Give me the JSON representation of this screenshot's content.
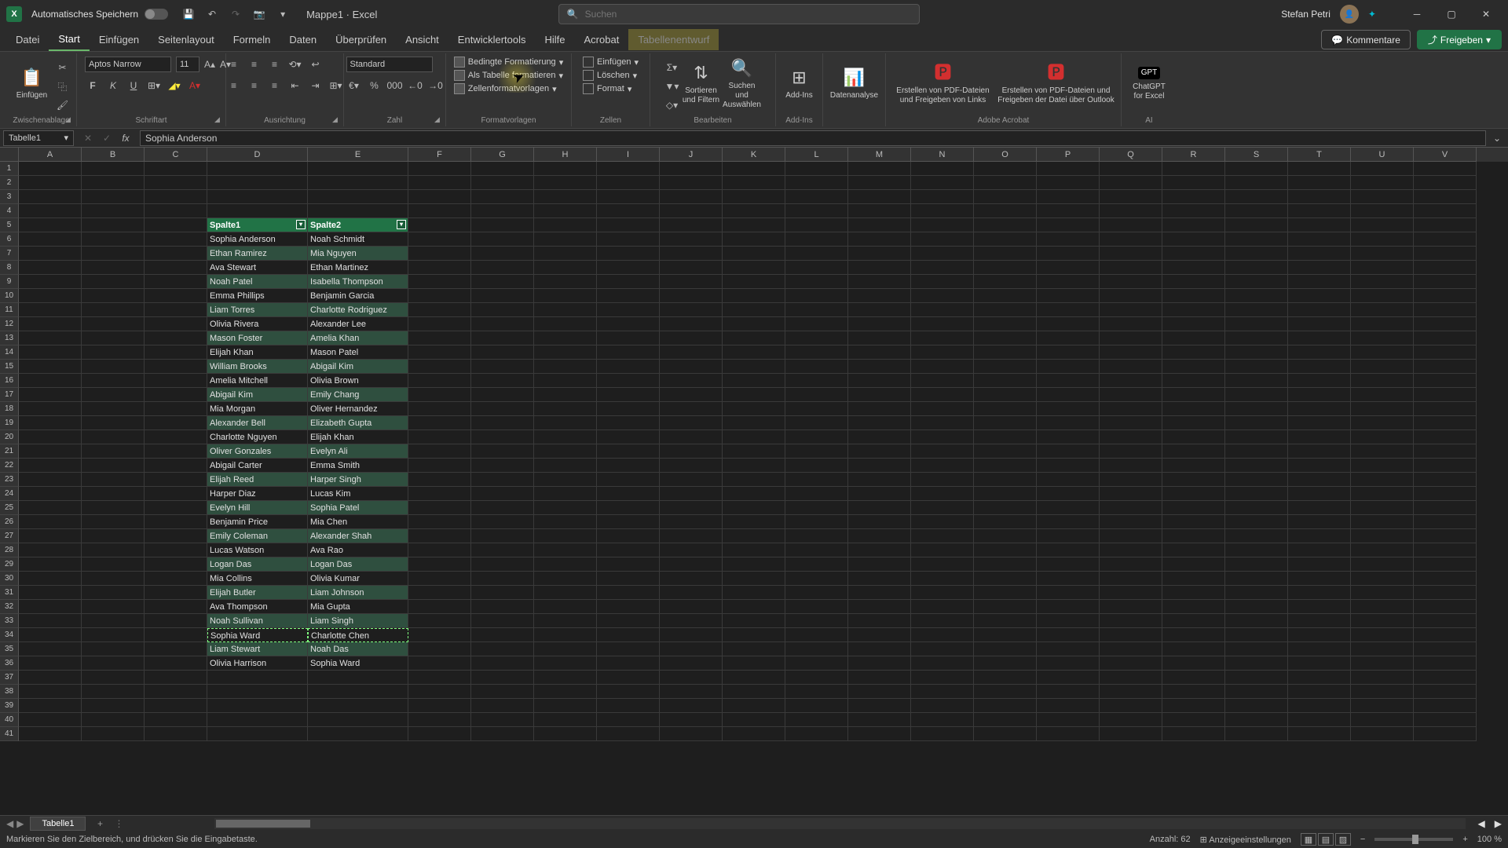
{
  "titlebar": {
    "autosave_label": "Automatisches Speichern",
    "filename": "Mappe1",
    "app": "Excel",
    "search_placeholder": "Suchen",
    "username": "Stefan Petri"
  },
  "tabs": {
    "items": [
      "Datei",
      "Start",
      "Einfügen",
      "Seitenlayout",
      "Formeln",
      "Daten",
      "Überprüfen",
      "Ansicht",
      "Entwicklertools",
      "Hilfe",
      "Acrobat",
      "Tabellenentwurf"
    ],
    "active": "Start",
    "kommentare": "Kommentare",
    "freigeben": "Freigeben"
  },
  "ribbon": {
    "clipboard": {
      "paste": "Einfügen",
      "label": "Zwischenablage"
    },
    "font": {
      "name": "Aptos Narrow",
      "size": "11",
      "label": "Schriftart"
    },
    "align": {
      "label": "Ausrichtung"
    },
    "number": {
      "format": "Standard",
      "label": "Zahl"
    },
    "styles": {
      "cond": "Bedingte Formatierung",
      "table": "Als Tabelle formatieren",
      "cell": "Zellenformatvorlagen",
      "label": "Formatvorlagen"
    },
    "cells": {
      "insert": "Einfügen",
      "delete": "Löschen",
      "format": "Format",
      "label": "Zellen"
    },
    "edit": {
      "sort": "Sortieren und Filtern",
      "find": "Suchen und Auswählen",
      "label": "Bearbeiten"
    },
    "addins": {
      "label": "Add-Ins",
      "btn": "Add-Ins"
    },
    "data_analysis": "Datenanalyse",
    "acrobat": {
      "pdf1": "Erstellen von PDF-Dateien und Freigeben von Links",
      "pdf2": "Erstellen von PDF-Dateien und Freigeben der Datei über Outlook",
      "label": "Adobe Acrobat"
    },
    "ai": {
      "gpt": "ChatGPT for Excel",
      "label": "AI"
    }
  },
  "formula": {
    "name_box": "Tabelle1",
    "content": "Sophia Anderson"
  },
  "grid": {
    "columns": [
      "A",
      "B",
      "C",
      "D",
      "E",
      "F",
      "G",
      "H",
      "I",
      "J",
      "K",
      "L",
      "M",
      "N",
      "O",
      "P",
      "Q",
      "R",
      "S",
      "T",
      "U",
      "V"
    ],
    "col_widths": {
      "A": 80,
      "B": 80,
      "C": 80,
      "D": 128,
      "E": 128,
      "default": 80
    },
    "table_start_row": 5,
    "table_col_d_header": "Spalte1",
    "table_col_e_header": "Spalte2",
    "table_rows": [
      [
        "Sophia Anderson",
        "Noah Schmidt"
      ],
      [
        "Ethan Ramirez",
        "Mia Nguyen"
      ],
      [
        "Ava Stewart",
        "Ethan Martinez"
      ],
      [
        "Noah Patel",
        "Isabella Thompson"
      ],
      [
        "Emma Phillips",
        "Benjamin Garcia"
      ],
      [
        "Liam Torres",
        "Charlotte Rodriguez"
      ],
      [
        "Olivia Rivera",
        "Alexander Lee"
      ],
      [
        "Mason Foster",
        "Amelia Khan"
      ],
      [
        "Elijah Khan",
        "Mason Patel"
      ],
      [
        "William Brooks",
        "Abigail Kim"
      ],
      [
        "Amelia Mitchell",
        "Olivia Brown"
      ],
      [
        "Abigail Kim",
        "Emily Chang"
      ],
      [
        "Mia Morgan",
        "Oliver Hernandez"
      ],
      [
        "Alexander Bell",
        "Elizabeth Gupta"
      ],
      [
        "Charlotte Nguyen",
        "Elijah Khan"
      ],
      [
        "Oliver Gonzales",
        "Evelyn Ali"
      ],
      [
        "Abigail Carter",
        "Emma Smith"
      ],
      [
        "Elijah Reed",
        "Harper Singh"
      ],
      [
        "Harper Diaz",
        "Lucas Kim"
      ],
      [
        "Evelyn Hill",
        "Sophia Patel"
      ],
      [
        "Benjamin Price",
        "Mia Chen"
      ],
      [
        "Emily Coleman",
        "Alexander Shah"
      ],
      [
        "Lucas Watson",
        "Ava Rao"
      ],
      [
        "Logan Das",
        "Logan Das"
      ],
      [
        "Mia Collins",
        "Olivia Kumar"
      ],
      [
        "Elijah Butler",
        "Liam Johnson"
      ],
      [
        "Ava Thompson",
        "Mia Gupta"
      ],
      [
        "Noah Sullivan",
        "Liam Singh"
      ],
      [
        "Sophia Ward",
        "Charlotte Chen"
      ],
      [
        "Liam Stewart",
        "Noah Das"
      ],
      [
        "Olivia Harrison",
        "Sophia Ward"
      ]
    ]
  },
  "sheets": {
    "active": "Tabelle1"
  },
  "status": {
    "message": "Markieren Sie den Zielbereich, und drücken Sie die Eingabetaste.",
    "anzahl_label": "Anzahl:",
    "anzahl_value": "62",
    "display_settings": "Anzeigeeinstellungen",
    "zoom": "100 %"
  }
}
